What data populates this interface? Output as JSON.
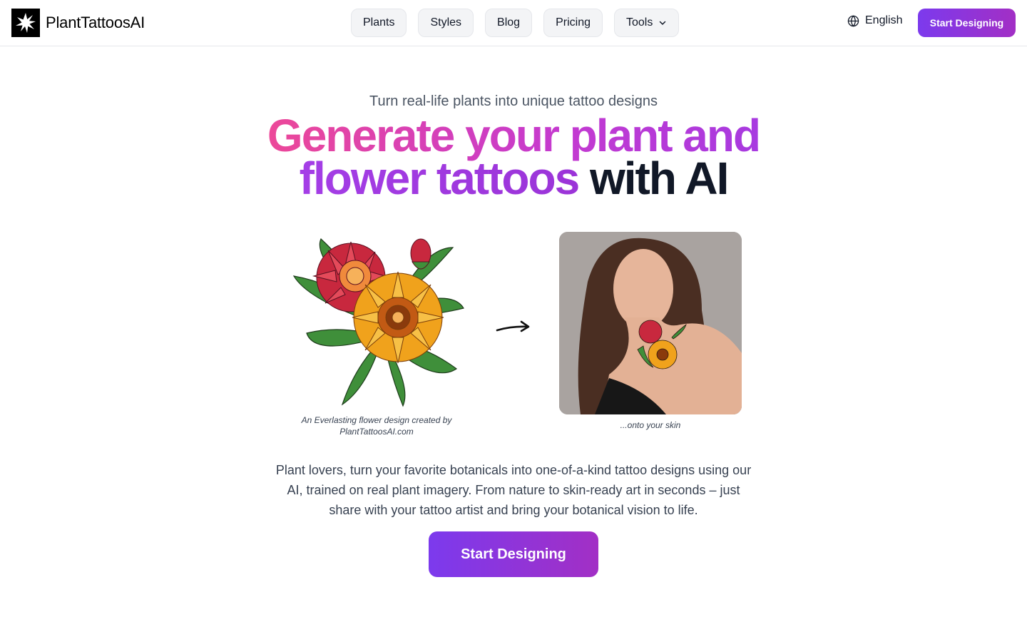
{
  "header": {
    "brand": "PlantTattoosAI",
    "nav": [
      {
        "label": "Plants"
      },
      {
        "label": "Styles"
      },
      {
        "label": "Blog"
      },
      {
        "label": "Pricing"
      },
      {
        "label": "Tools"
      }
    ],
    "language": "English",
    "cta": "Start Designing"
  },
  "hero": {
    "eyebrow": "Turn real-life plants into unique tattoo designs",
    "headline_part1": "Generate your plant and",
    "headline_part2": "flower tattoos",
    "headline_part3": " with AI",
    "caption_left": "An Everlasting flower design created by PlantTattoosAI.com",
    "caption_right": "...onto your skin",
    "description": "Plant lovers, turn your favorite botanicals into one-of-a-kind tattoo designs using our AI, trained on real plant imagery. From nature to skin-ready art in seconds – just share with your tattoo artist and bring your botanical vision to life.",
    "cta": "Start Designing"
  },
  "colors": {
    "accent_start": "#7c3aed",
    "accent_end": "#a22fc5",
    "headline_pink": "#ec4899",
    "headline_purple": "#a43ee6"
  }
}
